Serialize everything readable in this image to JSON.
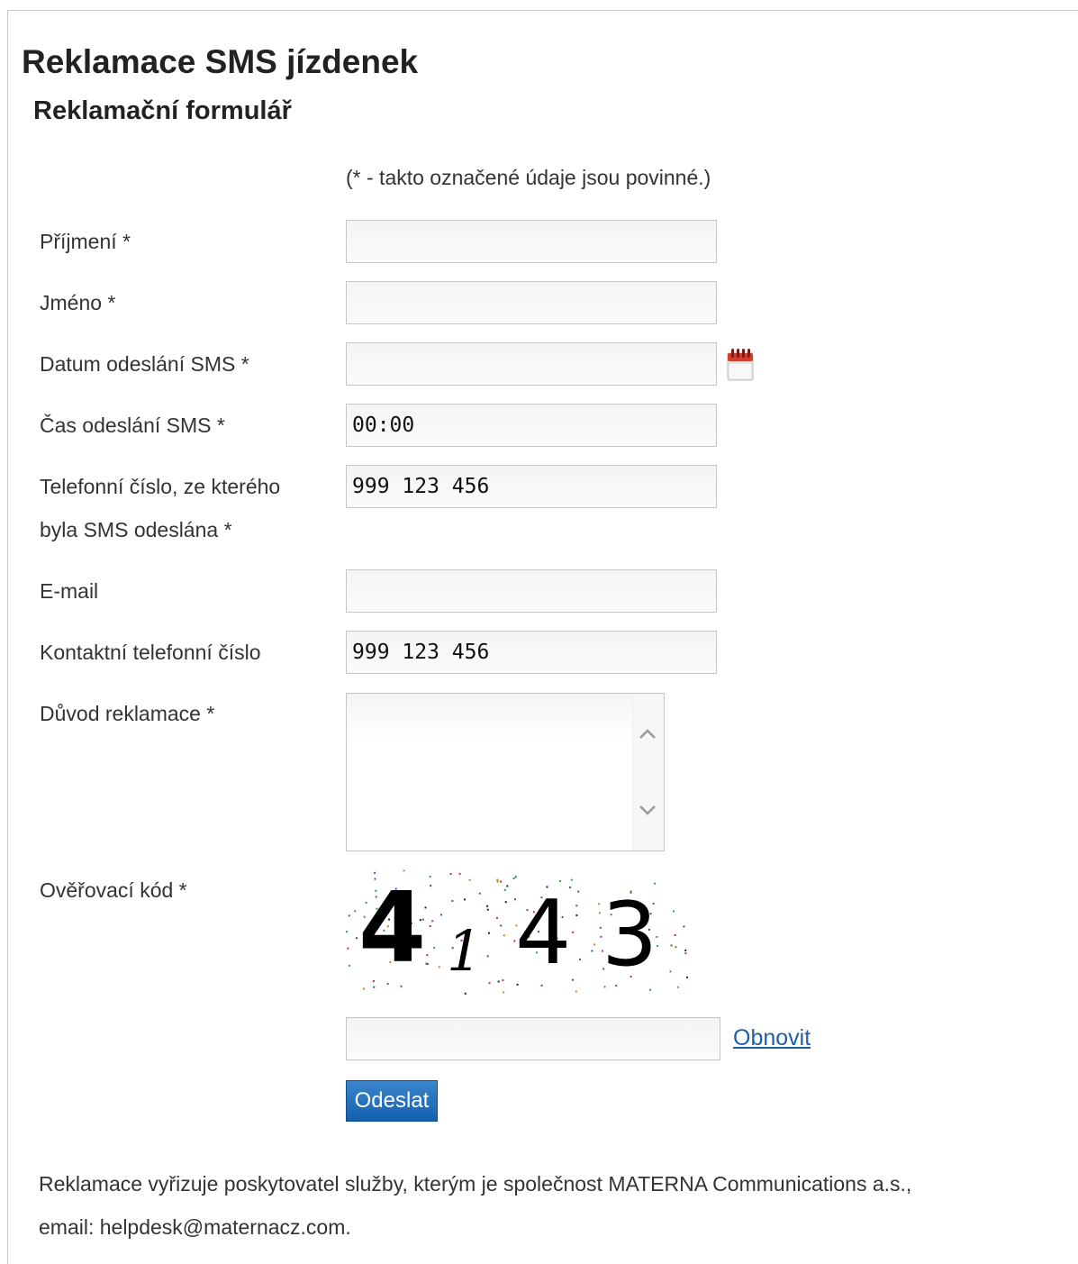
{
  "page": {
    "title": "Reklamace SMS jízdenek",
    "subtitle": "Reklamační formulář",
    "required_note": "(* - takto označené údaje jsou povinné.)"
  },
  "form": {
    "surname": {
      "label": "Příjmení *",
      "value": ""
    },
    "first_name": {
      "label": "Jméno *",
      "value": ""
    },
    "sms_date": {
      "label": "Datum odeslání SMS *",
      "value": "",
      "icon": "calendar-icon"
    },
    "sms_time": {
      "label": "Čas odeslání SMS *",
      "value": "00:00"
    },
    "phone_sender": {
      "label_line1": "Telefonní číslo, ze kterého",
      "label_line2": "byla SMS odeslána *",
      "value": "999 123 456"
    },
    "email": {
      "label": "E-mail",
      "value": ""
    },
    "contact_phone": {
      "label": "Kontaktní telefonní číslo",
      "value": "999 123 456"
    },
    "reason": {
      "label": "Důvod reklamace *",
      "value": ""
    },
    "captcha": {
      "label": "Ověřovací kód *",
      "chars": [
        "4",
        "1",
        "4",
        "3"
      ],
      "value": "",
      "refresh_label": "Obnovit"
    },
    "submit_label": "Odeslat"
  },
  "footer": {
    "line1": "Reklamace vyřizuje poskytovatel služby, kterým je společnost MATERNA Communications a.s.,",
    "line2": "email: helpdesk@maternacz.com."
  },
  "colors": {
    "button": "#1f6fb8",
    "link": "#1f5fa8",
    "text": "#333333"
  }
}
